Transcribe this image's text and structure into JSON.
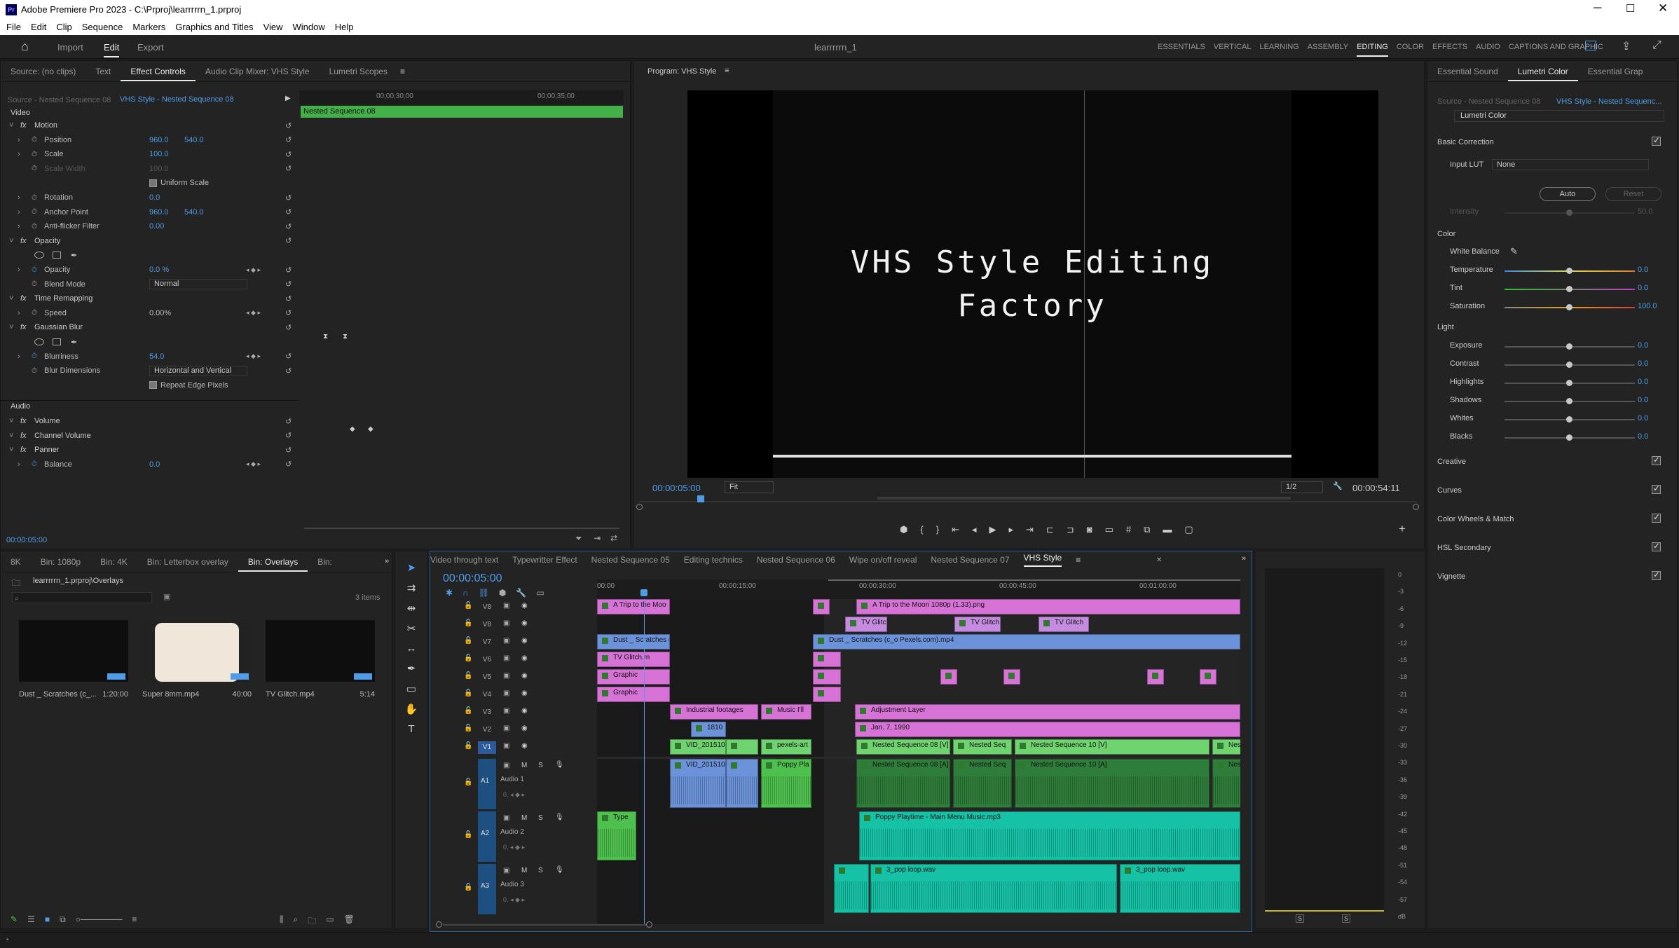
{
  "app": {
    "title": "Adobe Premiere Pro 2023 - C:\\Prproj\\learrrrrn_1.prproj",
    "project_name": "learrrrrn_1"
  },
  "menu": [
    "File",
    "Edit",
    "Clip",
    "Sequence",
    "Markers",
    "Graphics and Titles",
    "View",
    "Window",
    "Help"
  ],
  "header": {
    "tabs": [
      "Import",
      "Edit",
      "Export"
    ],
    "workspaces": [
      "ESSENTIALS",
      "VERTICAL",
      "LEARNING",
      "ASSEMBLY",
      "EDITING",
      "COLOR",
      "EFFECTS",
      "AUDIO",
      "CAPTIONS AND GRAPHIC"
    ]
  },
  "ec": {
    "tabs": [
      "Source: (no clips)",
      "Text",
      "Effect Controls",
      "Audio Clip Mixer: VHS Style",
      "Lumetri Scopes"
    ],
    "source_label": "Source - Nested Sequence 08",
    "seq_label": "VHS Style - Nested Sequence 08",
    "time1": "00;00;30;00",
    "time2": "00;00;35;00",
    "clip_label": "Nested Sequence 08",
    "video": "Video",
    "audio": "Audio",
    "footer_time": "00:00:05:00",
    "rows": [
      {
        "fx": true,
        "name": "Motion"
      },
      {
        "name": "Position",
        "v1": "960.0",
        "v2": "540.0",
        "stop": true
      },
      {
        "name": "Scale",
        "v1": "100.0",
        "stop": true
      },
      {
        "name": "Scale Width",
        "v1": "100.0",
        "dim": true
      },
      {
        "name": "",
        "check": "Uniform Scale"
      },
      {
        "name": "Rotation",
        "v1": "0.0",
        "stop": true
      },
      {
        "name": "Anchor Point",
        "v1": "960.0",
        "v2": "540.0",
        "stop": true
      },
      {
        "name": "Anti-flicker Filter",
        "v1": "0.00",
        "stop": true
      },
      {
        "fx": true,
        "name": "Opacity"
      },
      {
        "name": "",
        "masks": true
      },
      {
        "name": "Opacity",
        "v1": "0.0 %",
        "stop": true,
        "kf": true
      },
      {
        "name": "Blend Mode",
        "select": "Normal"
      },
      {
        "fx": true,
        "name": "Time Remapping"
      },
      {
        "name": "Speed",
        "v1": "0.00%",
        "kf": true,
        "white": true
      },
      {
        "fx": true,
        "name": "Gaussian Blur"
      },
      {
        "name": "",
        "masks": true
      },
      {
        "name": "Blurriness",
        "v1": "54.0",
        "stop": true,
        "kf": true
      },
      {
        "name": "Blur Dimensions",
        "select": "Horizontal and Vertical"
      },
      {
        "name": "",
        "check": "Repeat Edge Pixels"
      }
    ],
    "audio_rows": [
      {
        "fx": true,
        "name": "Volume"
      },
      {
        "fx": true,
        "name": "Channel Volume"
      },
      {
        "fx": true,
        "name": "Panner"
      },
      {
        "name": "Balance",
        "v1": "0.0",
        "stop": true,
        "kf": true
      }
    ]
  },
  "program": {
    "tab": "Program: VHS Style",
    "title_line1": "VHS Style Editing",
    "title_line2": "Factory",
    "timecode": "00:00:05:00",
    "fit": "Fit",
    "res": "1/2",
    "duration": "00:00:54:11"
  },
  "lumetri": {
    "tabs": [
      "Essential Sound",
      "Lumetri Color",
      "Essential Grap"
    ],
    "source": "Source - Nested Sequence 08",
    "seq": "VHS Style - Nested Sequenc...",
    "effect": "Lumetri Color",
    "basic": "Basic Correction",
    "input_lut": "Input LUT",
    "lut_value": "None",
    "auto": "Auto",
    "reset": "Reset",
    "intensity": "Intensity",
    "intensity_val": "50.0",
    "color": "Color",
    "white_balance": "White Balance",
    "color_sliders": [
      {
        "name": "Temperature",
        "val": "0.0"
      },
      {
        "name": "Tint",
        "val": "0.0"
      },
      {
        "name": "Saturation",
        "val": "100.0"
      }
    ],
    "light": "Light",
    "light_sliders": [
      {
        "name": "Exposure",
        "val": "0.0"
      },
      {
        "name": "Contrast",
        "val": "0.0"
      },
      {
        "name": "Highlights",
        "val": "0.0"
      },
      {
        "name": "Shadows",
        "val": "0.0"
      },
      {
        "name": "Whites",
        "val": "0.0"
      },
      {
        "name": "Blacks",
        "val": "0.0"
      }
    ],
    "sections": [
      "Creative",
      "Curves",
      "Color Wheels & Match",
      "HSL Secondary",
      "Vignette"
    ]
  },
  "project": {
    "tabs": [
      "8K",
      "Bin: 1080p",
      "Bin: 4K",
      "Bin: Letterbox overlay",
      "Bin: Overlays",
      "Bin:"
    ],
    "path": "learrrrrn_1.prproj\\Overlays",
    "count": "3 items",
    "items": [
      {
        "name": "Dust _ Scratches (c_...",
        "dur": "1:20:00"
      },
      {
        "name": "Super 8mm.mp4",
        "dur": "40:00"
      },
      {
        "name": "TV Glitch.mp4",
        "dur": "5:14"
      }
    ]
  },
  "timeline": {
    "tabs": [
      "Video through text",
      "Typewritter Effect",
      "Nested Sequence 05",
      "Editing technics",
      "Nested Sequence 06",
      "Wipe on/off reveal",
      "Nested Sequence 07",
      "VHS Style"
    ],
    "timecode": "00:00:05:00",
    "ruler": [
      "00:00",
      "00:00:15:00",
      "00:00:30:00",
      "00:00:45:00",
      "00:01:00:00"
    ],
    "tracks_v": [
      "V8",
      "V8",
      "V7",
      "V6",
      "V5",
      "V4",
      "V3",
      "V2",
      "V1"
    ],
    "tracks_a": [
      {
        "id": "A1",
        "name": "Audio 1"
      },
      {
        "id": "A2",
        "name": "Audio 2"
      },
      {
        "id": "A3",
        "name": "Audio 3"
      }
    ],
    "clips": {
      "v9a": "A Trip to the Moo",
      "v9b": "A Trip to the Moon 1080p (1.33).png",
      "tv1": "TV Glitch",
      "tv2": "TV Glitch",
      "tv3": "TV Glitch",
      "dust1": "Dust _ Scratches (",
      "dust2": "Dust _ Scratches (c_o Pexels.com).mp4",
      "tvg": "TV Glitch.m",
      "gr1": "Graphic",
      "gr2": "Graphic",
      "ind": "Industrial footages",
      "mus": "Music I'll",
      "adj": "Adjustment Layer",
      "y1810": "1810",
      "jan": "Jan. 7, 1990",
      "vid1": "VID_201510",
      "pex": "pexels-art",
      "ns8v": "Nested Sequence 08 [V]",
      "nsq": "Nested Seq",
      "ns10v": "Nested Sequence 10 [V]",
      "nsse": "Nested Se",
      "nes": "Nes",
      "vid2": "VID_201510",
      "poppy": "Poppy Pla",
      "ns8a": "Nested Sequence 08 [A]",
      "ns10a": "Nested Sequence 10 [A]",
      "type": "Type",
      "poppy2": "Poppy Playtime - Main Menu Music.mp3",
      "pop1": "3_pop loop.wav",
      "pop2": "3_pop loop.wav"
    }
  },
  "meter": {
    "scale": [
      "0",
      "-3",
      "-6",
      "-9",
      "-12",
      "-15",
      "-18",
      "-21",
      "-24",
      "-27",
      "-30",
      "-33",
      "-36",
      "-39",
      "-42",
      "-45",
      "-48",
      "-51",
      "-54",
      "-57",
      "dB"
    ],
    "s": "S"
  }
}
